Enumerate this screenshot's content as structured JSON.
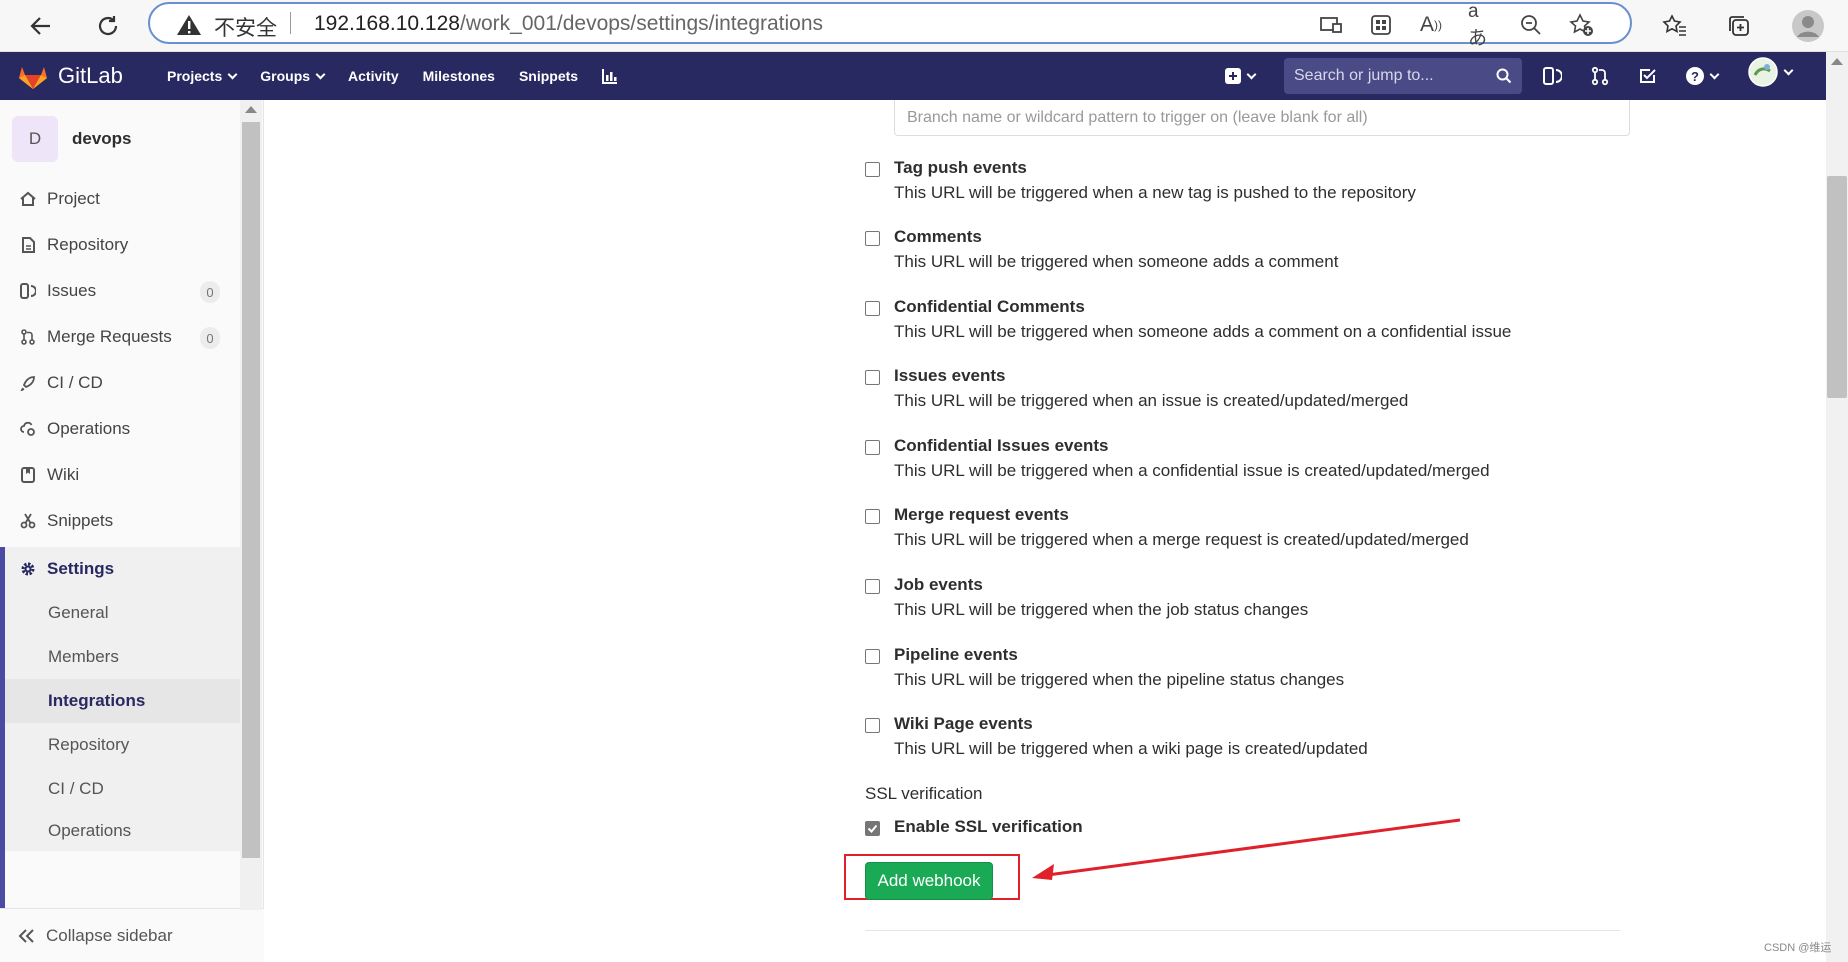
{
  "browser": {
    "security_label": "不安全",
    "url_host": "192.168.10.128",
    "url_path": "/work_001/devops/settings/integrations"
  },
  "header": {
    "logo_text": "GitLab",
    "nav": [
      "Projects",
      "Groups",
      "Activity",
      "Milestones",
      "Snippets"
    ],
    "search_placeholder": "Search or jump to..."
  },
  "sidebar": {
    "project_initial": "D",
    "project_name": "devops",
    "items": [
      {
        "label": "Project",
        "icon": "home-icon"
      },
      {
        "label": "Repository",
        "icon": "doc-icon"
      },
      {
        "label": "Issues",
        "icon": "issues-icon",
        "count": "0"
      },
      {
        "label": "Merge Requests",
        "icon": "merge-request-icon",
        "count": "0"
      },
      {
        "label": "CI / CD",
        "icon": "rocket-icon"
      },
      {
        "label": "Operations",
        "icon": "cloud-gear-icon"
      },
      {
        "label": "Wiki",
        "icon": "book-icon"
      },
      {
        "label": "Snippets",
        "icon": "scissors-icon"
      },
      {
        "label": "Settings",
        "icon": "gear-icon"
      }
    ],
    "settings_sub": [
      "General",
      "Members",
      "Integrations",
      "Repository",
      "CI / CD",
      "Operations"
    ],
    "collapse_label": "Collapse sidebar"
  },
  "main": {
    "branch_placeholder": "Branch name or wildcard pattern to trigger on (leave blank for all)",
    "events": [
      {
        "title": "Tag push events",
        "desc": "This URL will be triggered when a new tag is pushed to the repository",
        "checked": false
      },
      {
        "title": "Comments",
        "desc": "This URL will be triggered when someone adds a comment",
        "checked": false
      },
      {
        "title": "Confidential Comments",
        "desc": "This URL will be triggered when someone adds a comment on a confidential issue",
        "checked": false
      },
      {
        "title": "Issues events",
        "desc": "This URL will be triggered when an issue is created/updated/merged",
        "checked": false
      },
      {
        "title": "Confidential Issues events",
        "desc": "This URL will be triggered when a confidential issue is created/updated/merged",
        "checked": false
      },
      {
        "title": "Merge request events",
        "desc": "This URL will be triggered when a merge request is created/updated/merged",
        "checked": false
      },
      {
        "title": "Job events",
        "desc": "This URL will be triggered when the job status changes",
        "checked": false
      },
      {
        "title": "Pipeline events",
        "desc": "This URL will be triggered when the pipeline status changes",
        "checked": false
      },
      {
        "title": "Wiki Page events",
        "desc": "This URL will be triggered when a wiki page is created/updated",
        "checked": false
      }
    ],
    "ssl_section_label": "SSL verification",
    "ssl_checkbox_label": "Enable SSL verification",
    "ssl_checked": true,
    "add_button_label": "Add webhook"
  },
  "watermark": "CSDN @维运",
  "colors": {
    "header_bg": "#292961",
    "button_green": "#1aaa55",
    "annotation_red": "#e0202a"
  }
}
